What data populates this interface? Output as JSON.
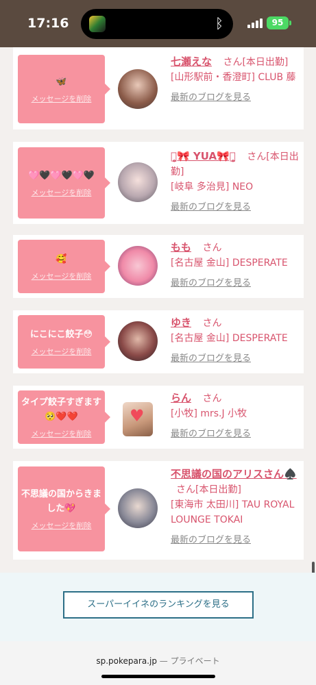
{
  "status_bar": {
    "time": "17:16",
    "battery": "95",
    "battery_color": "#4cd964"
  },
  "colors": {
    "accent": "#d8546d",
    "message_bg": "#f7939f",
    "ranking_border": "#2b6e86"
  },
  "cards": [
    {
      "message": "🦋",
      "delete": "メッセージを削除",
      "name": "七瀬えな",
      "san": "さん",
      "attendance": "[本日出勤]",
      "shop": "[山形駅前・香澄町] CLUB 藤",
      "blog": "最新のブログを見る"
    },
    {
      "message": "🩷🖤🩷🖤🩷🖤",
      "delete": "メッセージを削除",
      "name": "ꪔ̤̥🎀 YUA🎀ꪔ̤̥",
      "san": "さん",
      "attendance": "[本日出勤]",
      "shop": "[岐阜 多治見] NEO",
      "blog": "最新のブログを見る"
    },
    {
      "message": "🥰",
      "delete": "メッセージを削除",
      "name": "もも",
      "san": "さん",
      "attendance": "",
      "shop": "[名古屋 金山] DESPERATE",
      "blog": "最新のブログを見る"
    },
    {
      "message": "にこにこ餃子😳",
      "delete": "メッセージを削除",
      "name": "ゆき",
      "san": "さん",
      "attendance": "",
      "shop": "[名古屋 金山] DESPERATE",
      "blog": "最新のブログを見る"
    },
    {
      "message": "タイプ餃子すぎます🥺❤️❤️",
      "delete": "メッセージを削除",
      "name": "らん",
      "san": "さん",
      "attendance": "",
      "shop": "[小牧] mrs.J 小牧",
      "blog": "最新のブログを見る"
    },
    {
      "message": "不思議の国からきました💖",
      "delete": "メッセージを削除",
      "name": "不思議の国のアリスさん♠️",
      "san": "さん",
      "attendance": "[本日出勤]",
      "shop": "[東海市 太田川] TAU ROYAL LOUNGE TOKAI",
      "blog": "最新のブログを見る"
    }
  ],
  "ranking_button": "スーパーイイネのランキングを見る",
  "browser": {
    "url": "sp.pokepara.jp",
    "separator": " — ",
    "mode": "プライベート"
  }
}
